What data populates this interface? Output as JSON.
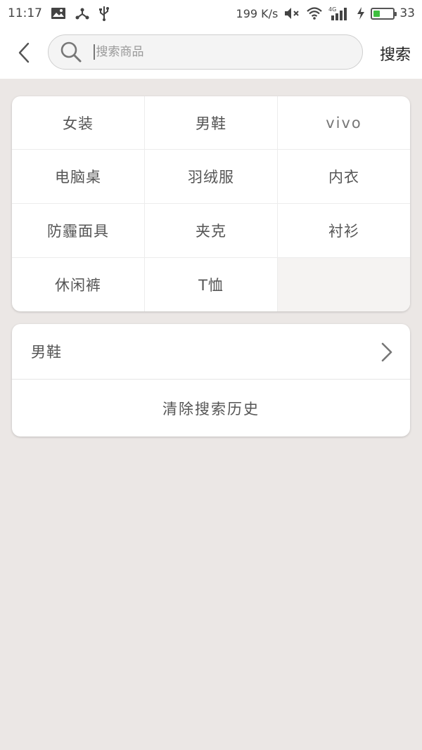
{
  "status_bar": {
    "time": "11:17",
    "net_speed": "199 K/s",
    "network_type": "4G",
    "battery_percent": "33",
    "battery_fill_fraction": 0.33,
    "icons": [
      "image-icon",
      "share-icon",
      "usb-icon",
      "mute-icon",
      "wifi-icon",
      "signal-icon",
      "charging-icon",
      "battery-icon"
    ]
  },
  "header": {
    "back_icon": "chevron-left-icon",
    "search_icon": "search-icon",
    "search_placeholder": "搜索商品",
    "search_value": "",
    "search_button": "搜索"
  },
  "hot_searches": [
    {
      "label": "女装"
    },
    {
      "label": "男鞋"
    },
    {
      "label": "vivo"
    },
    {
      "label": "电脑桌"
    },
    {
      "label": "羽绒服"
    },
    {
      "label": "内衣"
    },
    {
      "label": "防霾面具"
    },
    {
      "label": "夹克"
    },
    {
      "label": "衬衫"
    },
    {
      "label": "休闲裤"
    },
    {
      "label": "T恤"
    }
  ],
  "history": {
    "items": [
      {
        "label": "男鞋",
        "icon": "chevron-right-icon"
      }
    ],
    "clear_label": "清除搜索历史"
  },
  "colors": {
    "background": "#ebe7e5",
    "card": "#ffffff",
    "text": "#555555",
    "battery": "#3fbf3f"
  }
}
